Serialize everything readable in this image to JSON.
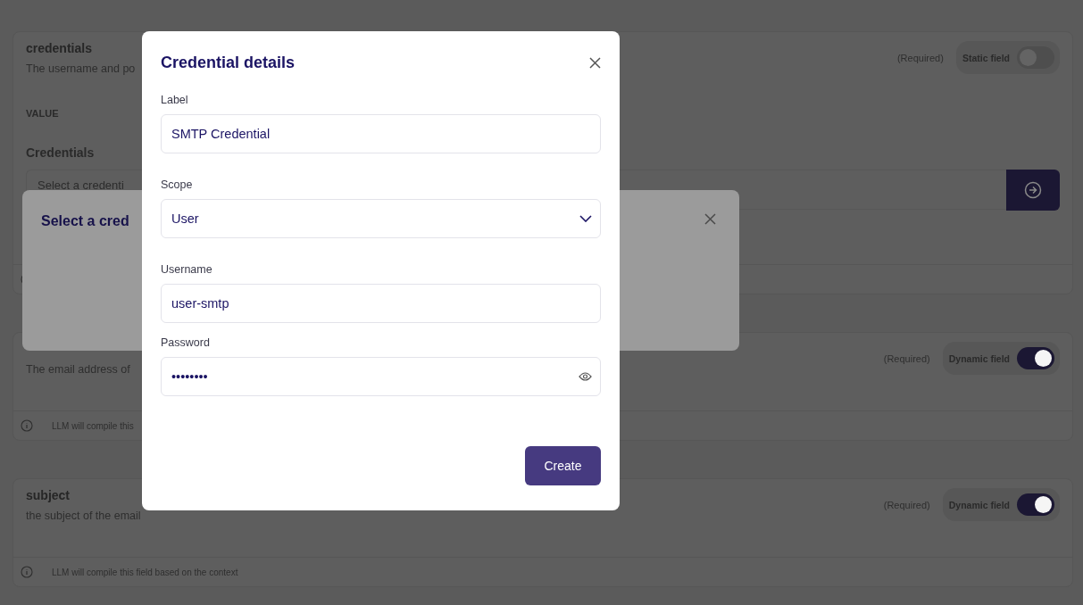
{
  "cards": [
    {
      "title": "credentials",
      "description": "The username and po",
      "required": "(Required)",
      "toggle": {
        "label": "Static field",
        "on": false
      },
      "value": {
        "heading": "VALUE",
        "field_label": "Credentials",
        "placeholder": "Select a credenti"
      }
    },
    {
      "description": "The email address of",
      "required": "(Required)",
      "toggle": {
        "label": "Dynamic field",
        "on": true
      },
      "footer": {
        "note": "LLM will compile this"
      }
    },
    {
      "title": "subject",
      "description": "the subject of the email",
      "required": "(Required)",
      "toggle": {
        "label": "Dynamic field",
        "on": true
      },
      "footer": {
        "note": "LLM will compile this field based on the context"
      }
    }
  ],
  "back_dialog": {
    "title": "Select a cred"
  },
  "dialog": {
    "title": "Credential details",
    "fields": [
      {
        "kind": "text",
        "label": "Label",
        "value": "SMTP Credential"
      },
      {
        "kind": "select",
        "label": "Scope",
        "value": "User"
      },
      {
        "kind": "text",
        "label": "Username",
        "value": "user-smtp"
      },
      {
        "kind": "password",
        "label": "Password",
        "value": "••••••••"
      }
    ],
    "submit": "Create"
  }
}
